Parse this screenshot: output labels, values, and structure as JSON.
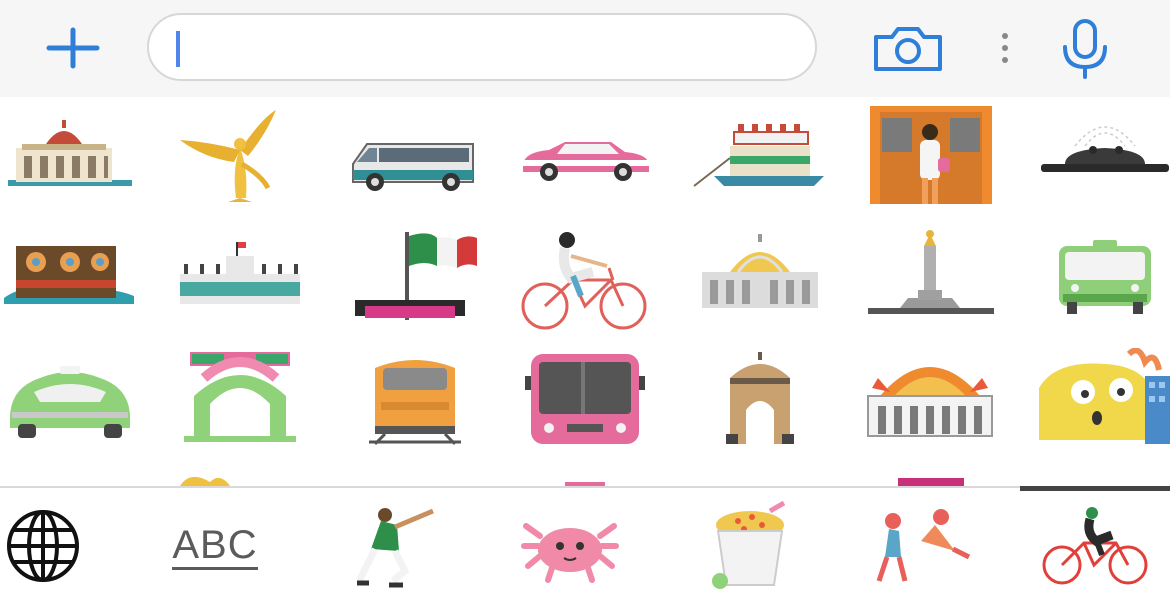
{
  "toolbar": {
    "add_icon": "plus-icon",
    "search_value": "",
    "camera_icon": "camera-icon",
    "more_icon": "more-vertical-icon",
    "mic_icon": "microphone-icon",
    "accent_color": "#2f7fd9"
  },
  "sticker_grid": {
    "rows": [
      [
        "palacio-de-bellas-artes",
        "angel-de-la-independencia",
        "microbus",
        "pink-taxi",
        "trajinera",
        "metro-doors",
        "fountain"
      ],
      [
        "mural-building",
        "zocalo-buildings",
        "cdmx-flag",
        "cyclist",
        "bellas-artes-dome",
        "independence-monument",
        "green-bus"
      ],
      [
        "vw-beetle-taxi",
        "arch-monument",
        "orange-metro-train",
        "pink-metrobus",
        "revolution-monument",
        "sunburst-palace",
        "yellow-axolotl-character"
      ]
    ]
  },
  "bottom_tabs": {
    "globe_icon": "globe-icon",
    "abc_label": "ABC",
    "categories": [
      "soccer-player",
      "axolotl",
      "esquites-cup",
      "wrestlers",
      "cyclist"
    ],
    "selected": "cyclist"
  }
}
